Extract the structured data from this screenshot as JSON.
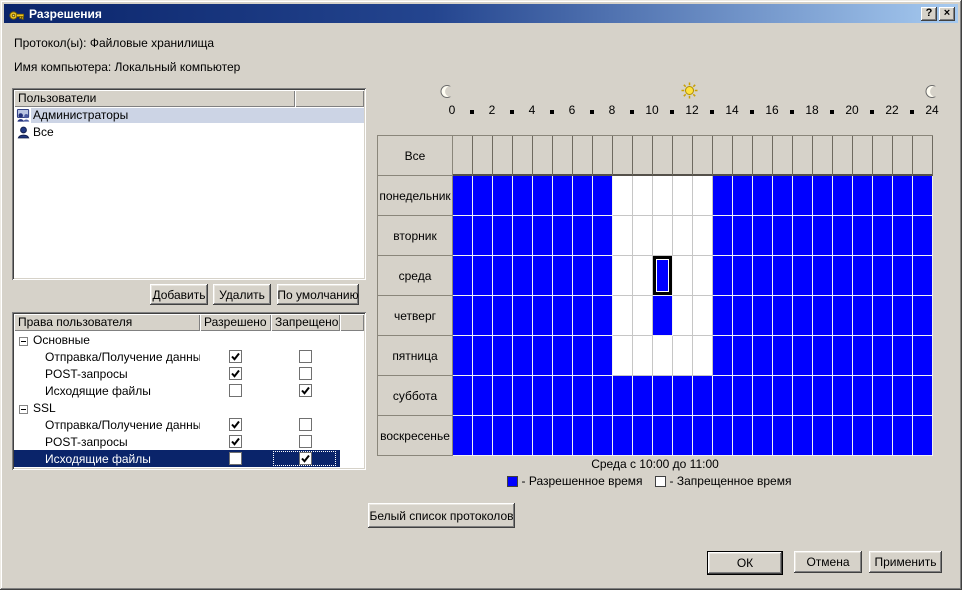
{
  "window": {
    "title": "Разрешения",
    "help": "?",
    "close": "×"
  },
  "info": {
    "protocols": "Протокол(ы): Файловые хранилища",
    "computer": "Имя компьютера: Локальный компьютер"
  },
  "users": {
    "header": "Пользователи",
    "items": [
      {
        "name": "Администраторы",
        "icon": "admins-group-icon",
        "selected": true
      },
      {
        "name": "Все",
        "icon": "user-icon",
        "selected": false
      }
    ]
  },
  "actions": {
    "add": "Добавить",
    "remove": "Удалить",
    "default": "По умолчанию"
  },
  "rights": {
    "columns": [
      "Права пользователя",
      "Разрешено",
      "Запрещено"
    ],
    "rows": [
      {
        "type": "group",
        "label": "Основные"
      },
      {
        "type": "item",
        "label": "Отправка/Получение данных",
        "allowed": true,
        "denied": false
      },
      {
        "type": "item",
        "label": "POST-запросы",
        "allowed": true,
        "denied": false
      },
      {
        "type": "item",
        "label": "Исходящие файлы",
        "allowed": false,
        "denied": true
      },
      {
        "type": "group",
        "label": "SSL"
      },
      {
        "type": "item",
        "label": "Отправка/Получение данных",
        "allowed": true,
        "denied": false
      },
      {
        "type": "item",
        "label": "POST-запросы",
        "allowed": true,
        "denied": false
      },
      {
        "type": "item",
        "label": "Исходящие файлы",
        "allowed": false,
        "denied": true,
        "selected": true
      }
    ]
  },
  "schedule": {
    "tick_labels": [
      0,
      2,
      4,
      6,
      8,
      10,
      12,
      14,
      16,
      18,
      20,
      22,
      24
    ],
    "rows": [
      {
        "label": "Все",
        "type": "all-row"
      },
      {
        "label": "понедельник",
        "hours": "111111110000011111111111"
      },
      {
        "label": "вторник",
        "hours": "111111110000011111111111"
      },
      {
        "label": "среда",
        "hours": "111111110010011111111111"
      },
      {
        "label": "четверг",
        "hours": "111111110010011111111111"
      },
      {
        "label": "пятница",
        "hours": "111111110000011111111111"
      },
      {
        "label": "суббота",
        "hours": "111111111111111111111111"
      },
      {
        "label": "воскресенье",
        "hours": "111111111111111111111111"
      }
    ],
    "selected_cell": {
      "day": "среда",
      "hour": 10
    },
    "caption": "Среда с 10:00 до 11:00",
    "allowed_color": "#0000ff",
    "denied_color": "#ffffff",
    "legend": [
      {
        "color": "#0000ff",
        "label": "- Разрешенное время"
      },
      {
        "color": "#ffffff",
        "label": "- Запрещенное время"
      }
    ]
  },
  "whitelist_button": "Белый список протоколов",
  "footer": {
    "ok": "ОК",
    "cancel": "Отмена",
    "apply": "Применить"
  }
}
